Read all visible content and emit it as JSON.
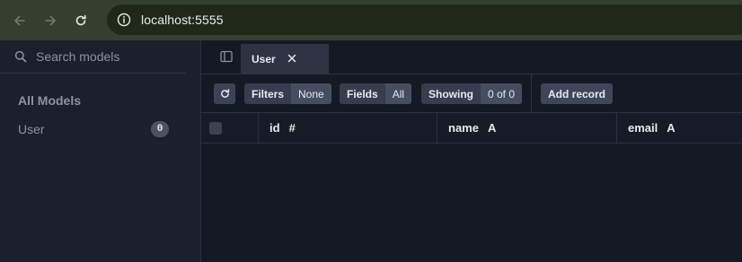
{
  "browser": {
    "url": "localhost:5555"
  },
  "sidebar": {
    "search_placeholder": "Search models",
    "section_title": "All Models",
    "models": [
      {
        "label": "User",
        "count": "0"
      }
    ]
  },
  "tabs": [
    {
      "label": "User",
      "active": true
    }
  ],
  "toolbar": {
    "filters_label": "Filters",
    "filters_value": "None",
    "fields_label": "Fields",
    "fields_value": "All",
    "showing_label": "Showing",
    "showing_value": "0 of 0",
    "add_record_label": "Add record"
  },
  "table": {
    "columns": [
      {
        "name": "id",
        "type_glyph": "#"
      },
      {
        "name": "name",
        "type_glyph": "A"
      },
      {
        "name": "email",
        "type_glyph": "A"
      }
    ],
    "rows": []
  },
  "colors": {
    "browser_bar": "#33402d",
    "background": "#141a24",
    "sidebar": "#1a202c",
    "tab_active": "#2c3444"
  }
}
